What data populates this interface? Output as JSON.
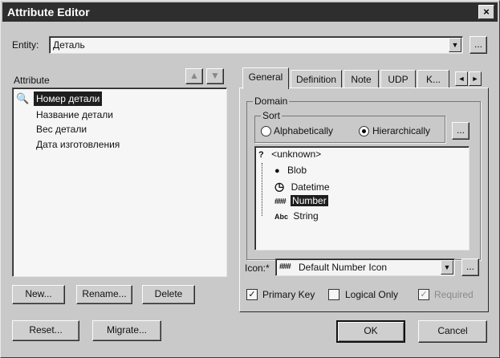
{
  "window": {
    "title": "Attribute Editor",
    "close": "×"
  },
  "entity": {
    "label": "Entity:",
    "value": "Деталь",
    "more": "..."
  },
  "attribute": {
    "label": "Attribute",
    "items": [
      {
        "label": "Номер детали"
      },
      {
        "label": "Название детали"
      },
      {
        "label": "Вес детали"
      },
      {
        "label": "Дата изготовления"
      }
    ]
  },
  "left_buttons": {
    "new": "New...",
    "rename": "Rename...",
    "delete": "Delete"
  },
  "bottom_buttons": {
    "reset": "Reset...",
    "migrate": "Migrate...",
    "ok": "OK",
    "cancel": "Cancel"
  },
  "tabs": [
    {
      "label": "General"
    },
    {
      "label": "Definition"
    },
    {
      "label": "Note"
    },
    {
      "label": "UDP"
    },
    {
      "label": "K..."
    }
  ],
  "domain": {
    "label": "Domain",
    "sort_label": "Sort",
    "sort_alpha": "Alphabetically",
    "sort_hier": "Hierarchically",
    "sort_more": "...",
    "tree": [
      {
        "label": "<unknown>",
        "icon": "?"
      },
      {
        "label": "Blob",
        "icon": "●"
      },
      {
        "label": "Datetime",
        "icon": "◷"
      },
      {
        "label": "Number",
        "icon": "###"
      },
      {
        "label": "String",
        "icon": "Abc"
      }
    ]
  },
  "icon_field": {
    "label": "Icon:*",
    "value": "Default Number Icon",
    "glyph": "###",
    "more": "..."
  },
  "checks": {
    "primary_key": "Primary Key",
    "logical_only": "Logical Only",
    "required": "Required"
  }
}
